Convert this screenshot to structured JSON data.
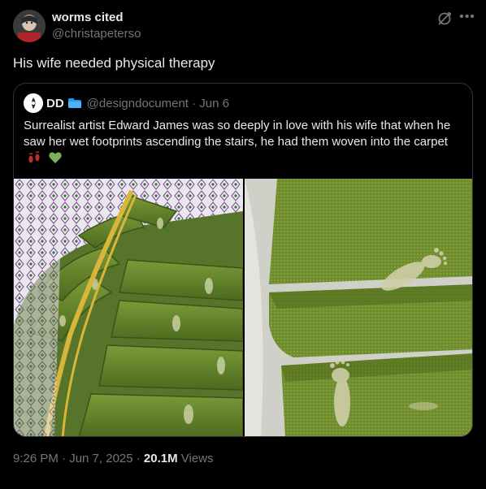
{
  "author": {
    "name": "worms cited",
    "handle": "@christapeterso"
  },
  "tweet": {
    "text": "His wife needed physical therapy"
  },
  "quote": {
    "name": "DD",
    "handle_and_date": "@designdocument · Jun 6",
    "text": "Surrealist artist Edward James was so deeply in love with his wife that when he saw her wet footprints ascending the stairs, he had them woven into the carpet",
    "emojis": [
      "footprints",
      "green-heart"
    ]
  },
  "meta": {
    "time": "9:26 PM · Jun 7, 2025 · ",
    "views_count": "20.1M",
    "views_label": " Views"
  },
  "icons": {
    "grok": "grok-icon",
    "more": "more-options-icon"
  },
  "colors": {
    "background": "#000000",
    "text": "#e7e9ea",
    "secondary": "#71767b",
    "border": "#2f3336",
    "carpet_green": "#6b8a2c"
  }
}
